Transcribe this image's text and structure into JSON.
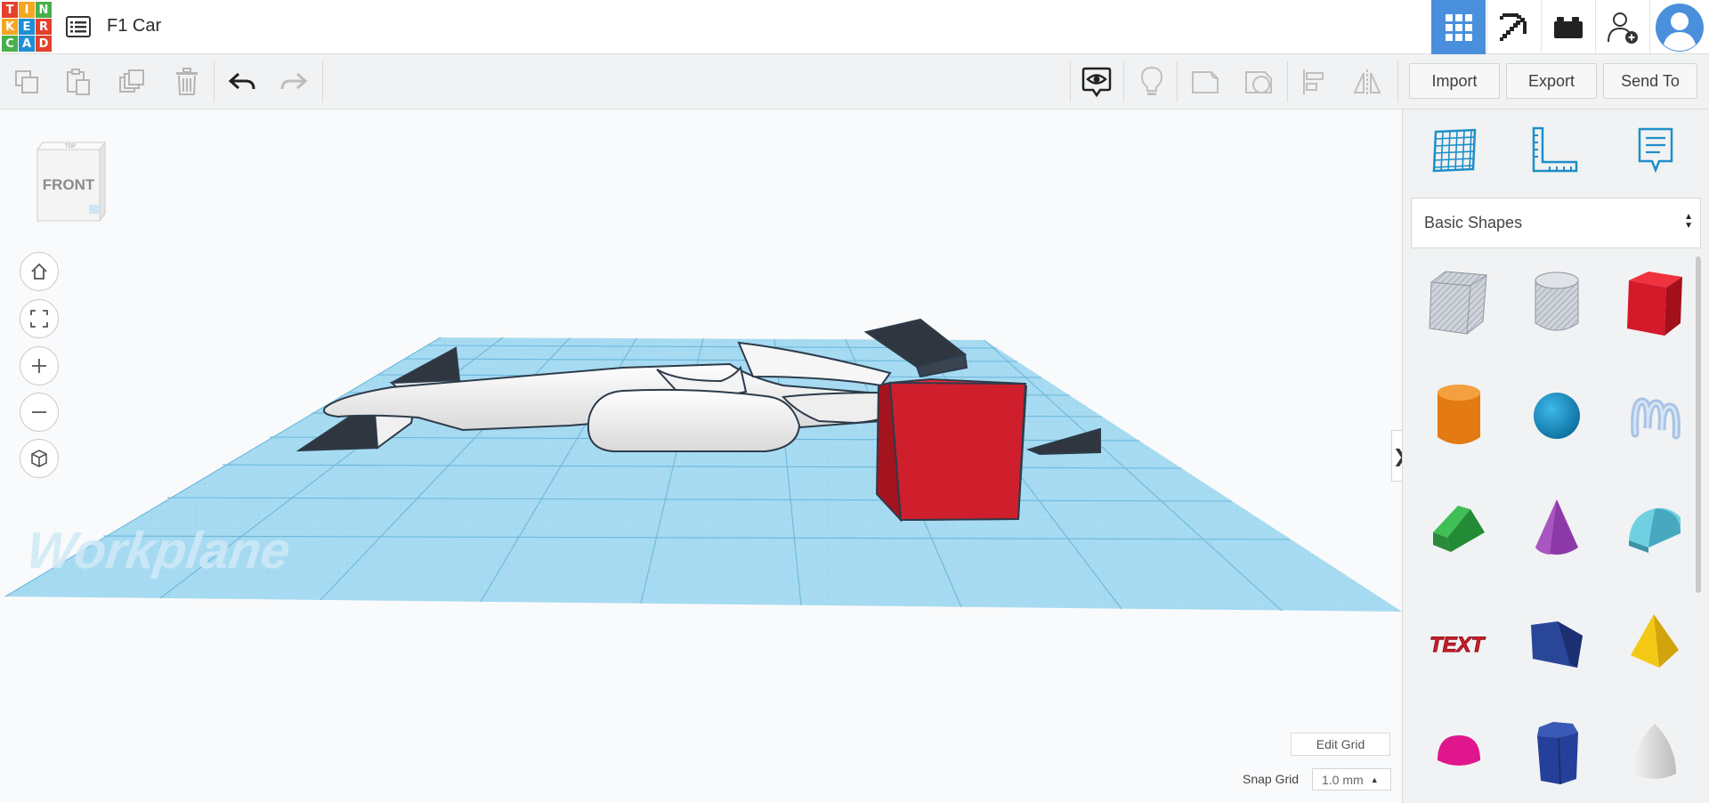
{
  "app": {
    "logo_letters": [
      "T",
      "I",
      "N",
      "K",
      "E",
      "R",
      "C",
      "A",
      "D"
    ],
    "logo_colors": [
      "#e2412d",
      "#f5a623",
      "#47b04b",
      "#f5a623",
      "#1e8fd4",
      "#e2412d",
      "#47b04b",
      "#1e8fd4",
      "#e2412d"
    ],
    "title": "F1 Car",
    "accent": "#4a8fdc"
  },
  "header": {
    "icons": [
      "grid-view-icon",
      "pickaxe-icon",
      "bricks-icon",
      "add-user-icon",
      "avatar-icon"
    ]
  },
  "toolbar": {
    "left_icons": [
      "copy-icon",
      "paste-icon",
      "duplicate-icon",
      "delete-icon",
      "undo-icon",
      "redo-icon"
    ],
    "right_icons": [
      "notes-visibility-icon",
      "lightbulb-icon",
      "shape-solid-icon",
      "shape-hole-icon",
      "align-icon",
      "mirror-icon"
    ],
    "import_label": "Import",
    "export_label": "Export",
    "sendto_label": "Send To"
  },
  "viewport": {
    "viewcube_top": "TOP",
    "viewcube_face": "FRONT",
    "workplane_label": "Workplane",
    "edit_grid_label": "Edit Grid",
    "snap_grid_label": "Snap Grid",
    "snap_grid_value": "1.0 mm",
    "object_colors": {
      "body": "#f2f2f2",
      "wing": "#2f3640",
      "box": "#d0202d",
      "grid": "#9fd4ee"
    }
  },
  "panel": {
    "tabs": [
      "workplane-grid-icon",
      "ruler-icon",
      "notes-icon"
    ],
    "shapes_dropdown": "Basic Shapes",
    "shape_text_label": "TEXT",
    "shapes": [
      {
        "name": "box-hole",
        "color": "#c9ccd3"
      },
      {
        "name": "cylinder-hole",
        "color": "#c9ccd3"
      },
      {
        "name": "box",
        "color": "#d91f2c"
      },
      {
        "name": "cylinder",
        "color": "#f08a1c"
      },
      {
        "name": "sphere",
        "color": "#1a8fc9"
      },
      {
        "name": "scribble",
        "color": "#a9c4e6"
      },
      {
        "name": "roof",
        "color": "#2ea043"
      },
      {
        "name": "cone",
        "color": "#8d3aa8"
      },
      {
        "name": "round-roof",
        "color": "#5ec2d6"
      },
      {
        "name": "text",
        "color": "#d21d2a"
      },
      {
        "name": "wedge",
        "color": "#233b8a"
      },
      {
        "name": "pyramid",
        "color": "#f2c20f"
      },
      {
        "name": "half-sphere",
        "color": "#e0168c"
      },
      {
        "name": "polygon",
        "color": "#24409a"
      },
      {
        "name": "paraboloid",
        "color": "#dcdcdc"
      }
    ]
  },
  "collapse_glyph": "❯"
}
